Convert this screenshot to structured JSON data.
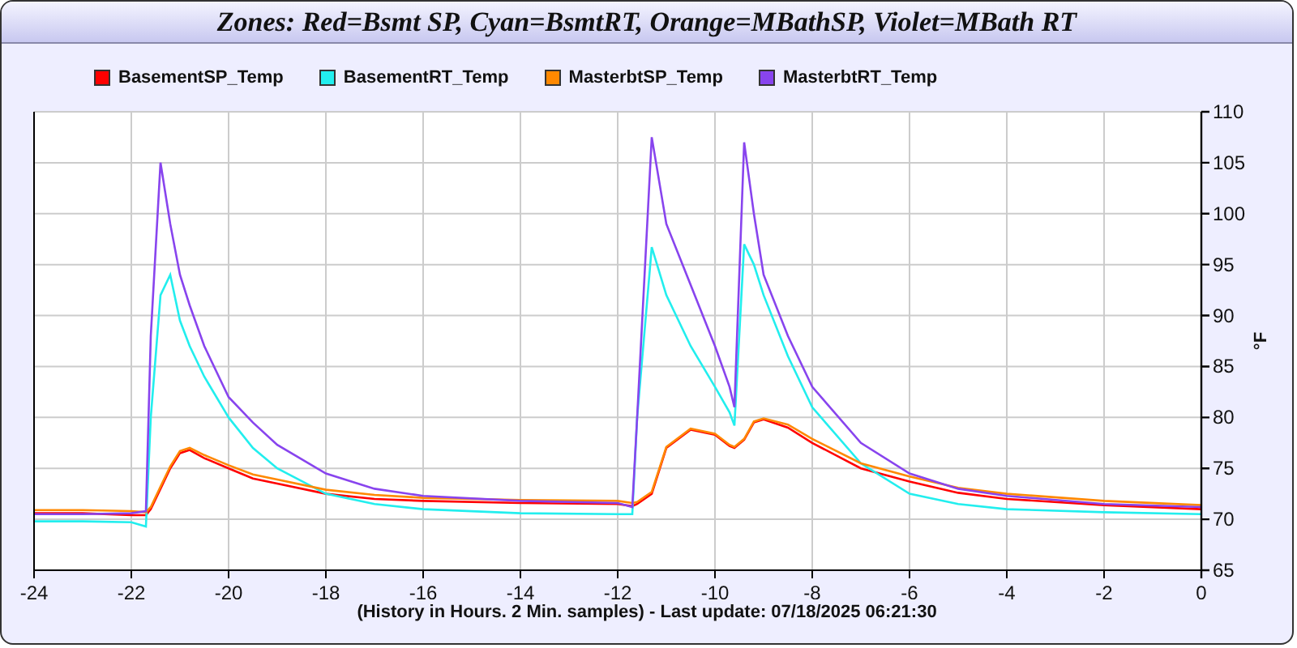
{
  "title": "Zones: Red=Bsmt SP, Cyan=BsmtRT, Orange=MBathSP, Violet=MBath RT",
  "chart": {
    "chart_data": {
      "type": "line",
      "xlabel": "(History in Hours. 2 Min. samples) - Last update: 07/18/2025 06:21:30",
      "ylabel": "°F",
      "x": [
        -24,
        -23,
        -22,
        -21.7,
        -21.6,
        -21.4,
        -21.2,
        -21,
        -20.8,
        -20.5,
        -20,
        -19.5,
        -19,
        -18,
        -17,
        -16,
        -14,
        -12,
        -11.7,
        -11.6,
        -11.3,
        -11,
        -10.5,
        -10,
        -9.7,
        -9.6,
        -9.4,
        -9.2,
        -9,
        -8.5,
        -8,
        -7,
        -6,
        -5,
        -4,
        -2,
        0
      ],
      "series": [
        {
          "name": "BasementSP_Temp",
          "color": "#ff0000",
          "values": [
            70.6,
            70.6,
            70.4,
            70.4,
            71,
            73,
            75,
            76.5,
            76.8,
            76,
            75,
            74,
            73.5,
            72.5,
            72,
            71.8,
            71.6,
            71.5,
            71.3,
            71.5,
            72.5,
            77,
            78.8,
            78.3,
            77.2,
            77,
            77.8,
            79.5,
            79.8,
            79,
            77.5,
            75,
            73.7,
            72.6,
            72,
            71.4,
            71
          ]
        },
        {
          "name": "BasementRT_Temp",
          "color": "#22eeee",
          "values": [
            69.8,
            69.8,
            69.7,
            69.3,
            80,
            92,
            94,
            89.5,
            87,
            84,
            80,
            77,
            75,
            72.5,
            71.5,
            71,
            70.6,
            70.5,
            70.5,
            80,
            96.7,
            92,
            87,
            83,
            80.5,
            79.2,
            97,
            95,
            92,
            86,
            81,
            75.5,
            72.5,
            71.5,
            71,
            70.7,
            70.5
          ]
        },
        {
          "name": "MasterbtSP_Temp",
          "color": "#ff8800",
          "values": [
            70.9,
            70.9,
            70.8,
            70.7,
            71.2,
            73.2,
            75.2,
            76.7,
            77,
            76.3,
            75.3,
            74.4,
            73.9,
            72.9,
            72.4,
            72.1,
            71.9,
            71.8,
            71.6,
            71.7,
            72.7,
            77.1,
            78.9,
            78.4,
            77.3,
            77.1,
            77.9,
            79.6,
            79.9,
            79.3,
            77.9,
            75.5,
            74.2,
            73.1,
            72.5,
            71.8,
            71.4
          ]
        },
        {
          "name": "MasterbtRT_Temp",
          "color": "#8844ee",
          "values": [
            70.5,
            70.5,
            70.6,
            70.8,
            88,
            105,
            99,
            94,
            91,
            87,
            82,
            79.5,
            77.3,
            74.5,
            73,
            72.3,
            71.8,
            71.6,
            71.2,
            80,
            107.5,
            99,
            93,
            87,
            83,
            81,
            107,
            100,
            94,
            88,
            83,
            77.5,
            74.5,
            73,
            72.3,
            71.5,
            71.2
          ]
        }
      ],
      "grid": true,
      "xlim": [
        -24,
        0
      ],
      "ylim": [
        65,
        110
      ],
      "xticks": [
        -24,
        -22,
        -20,
        -18,
        -16,
        -14,
        -12,
        -10,
        -8,
        -6,
        -4,
        -2,
        0
      ],
      "yticks": [
        65,
        70,
        75,
        80,
        85,
        90,
        95,
        100,
        105,
        110
      ]
    }
  }
}
